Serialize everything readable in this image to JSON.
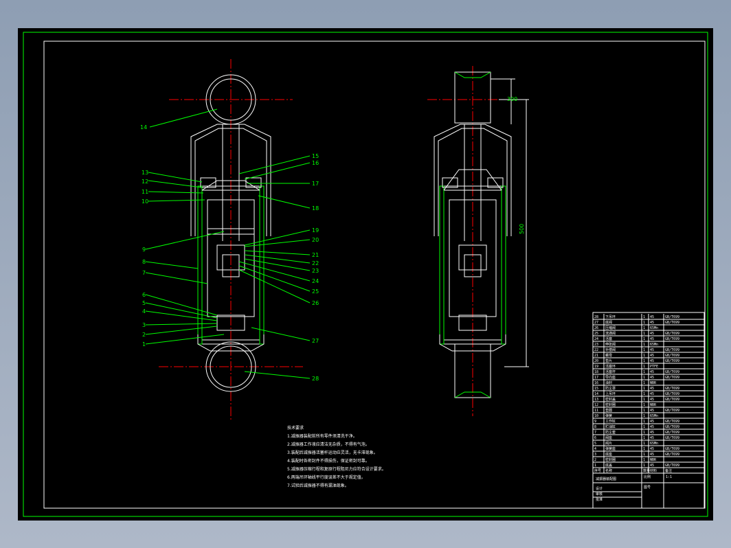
{
  "colors": {
    "background": "#000000",
    "frame": "#00ff00",
    "outline": "#ffffff",
    "centerline": "#ff0000",
    "chrome": "#9aa8bb"
  },
  "labels_left": [
    "13",
    "12",
    "11",
    "10",
    "9",
    "8",
    "7",
    "6",
    "5",
    "4",
    "3",
    "2",
    "1"
  ],
  "labels_top": "14",
  "labels_right": [
    "15",
    "16",
    "17",
    "18",
    "19",
    "20",
    "21",
    "22",
    "23",
    "24",
    "25",
    "26",
    "27",
    "28"
  ],
  "notes": {
    "title": "技术要求",
    "lines": [
      "1.减振器装配前所有零件须清洗干净。",
      "2.减振器工作液应清洁无杂质，不得有气泡。",
      "3.装配后减振器活塞杆运动应灵活，无卡滞现象。",
      "4.装配时各密封件不得损伤，保证密封可靠。",
      "5.减振器压缩行程和复原行程阻尼力应符合设计要求。",
      "6.两端吊环轴线平行度误差不大于规定值。",
      "7.试验后减振器不得有漏油现象。"
    ]
  },
  "dims": {
    "stroke": "300",
    "length": "500"
  },
  "bom": {
    "rows": [
      [
        "28",
        "下吊环",
        "1",
        "45",
        "GB/T699"
      ],
      [
        "27",
        "底阀",
        "1",
        "45",
        "GB/T699"
      ],
      [
        "26",
        "压缩阀",
        "1",
        "65Mn",
        ""
      ],
      [
        "25",
        "流通阀",
        "1",
        "45",
        "GB/T699"
      ],
      [
        "24",
        "活塞",
        "1",
        "45",
        "GB/T699"
      ],
      [
        "23",
        "伸张阀",
        "1",
        "65Mn",
        ""
      ],
      [
        "22",
        "补偿阀",
        "1",
        "45",
        "GB/T699"
      ],
      [
        "21",
        "螺母",
        "1",
        "45",
        "GB/T699"
      ],
      [
        "20",
        "垫片",
        "1",
        "45",
        "GB/T699"
      ],
      [
        "19",
        "活塞环",
        "1",
        "PTFE",
        ""
      ],
      [
        "18",
        "活塞杆",
        "1",
        "45",
        "GB/T699"
      ],
      [
        "17",
        "导向座",
        "1",
        "45",
        "GB/T699"
      ],
      [
        "16",
        "油封",
        "1",
        "NBR",
        ""
      ],
      [
        "15",
        "防尘罩",
        "1",
        "45",
        "GB/T699"
      ],
      [
        "14",
        "上吊环",
        "1",
        "45",
        "GB/T699"
      ],
      [
        "13",
        "密封盖",
        "1",
        "45",
        "GB/T699"
      ],
      [
        "12",
        "密封圈",
        "1",
        "NBR",
        ""
      ],
      [
        "11",
        "垫圈",
        "1",
        "45",
        "GB/T699"
      ],
      [
        "10",
        "弹簧",
        "1",
        "65Mn",
        ""
      ],
      [
        "9",
        "工作缸",
        "1",
        "45",
        "GB/T699"
      ],
      [
        "8",
        "贮油缸",
        "1",
        "45",
        "GB/T699"
      ],
      [
        "7",
        "防尘套",
        "1",
        "45",
        "GB/T699"
      ],
      [
        "6",
        "阀座",
        "1",
        "45",
        "GB/T699"
      ],
      [
        "5",
        "阀片",
        "1",
        "65Mn",
        ""
      ],
      [
        "4",
        "弹簧座",
        "1",
        "45",
        "GB/T699"
      ],
      [
        "3",
        "底座",
        "1",
        "45",
        "GB/T699"
      ],
      [
        "2",
        "密封圈",
        "1",
        "NBR",
        ""
      ],
      [
        "1",
        "底盖",
        "1",
        "45",
        "GB/T699"
      ]
    ],
    "header": [
      "序号",
      "名称",
      "数量",
      "材料",
      "备注"
    ],
    "title": "减振器装配图",
    "fields": [
      "比例",
      "1:1",
      "图号",
      "设计",
      "审核",
      "批准"
    ]
  }
}
